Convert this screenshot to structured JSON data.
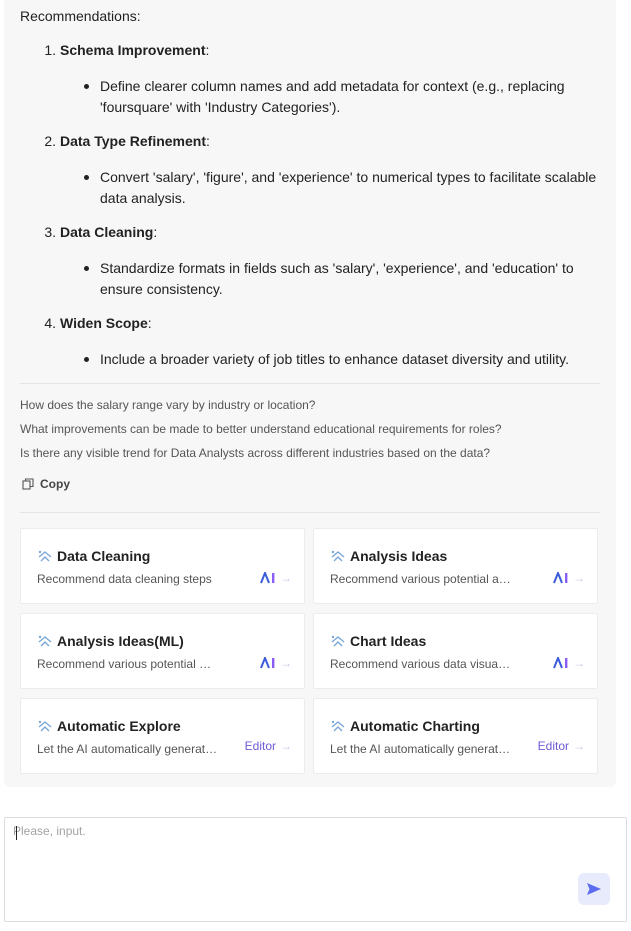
{
  "message": {
    "heading": "Recommendations:",
    "items": [
      {
        "num": "1.",
        "title": "Schema Improvement",
        "suffix": ":",
        "detail": "Define clearer column names and add metadata for context (e.g., replacing 'foursquare' with 'Industry Categories')."
      },
      {
        "num": "2.",
        "title": "Data Type Refinement",
        "suffix": ":",
        "detail": "Convert 'salary', 'figure', and 'experience' to numerical types to facilitate scalable data analysis."
      },
      {
        "num": "3.",
        "title": "Data Cleaning",
        "suffix": ":",
        "detail": "Standardize formats in fields such as 'salary', 'experience', and 'education' to ensure consistency."
      },
      {
        "num": "4.",
        "title": "Widen Scope",
        "suffix": ":",
        "detail": "Include a broader variety of job titles to enhance dataset diversity and utility."
      }
    ]
  },
  "suggestions": [
    "How does the salary range vary by industry or location?",
    "What improvements can be made to better understand educational requirements for roles?",
    "Is there any visible trend for Data Analysts across different industries based on the data?"
  ],
  "copy_label": "Copy",
  "cards": [
    {
      "title": "Data Cleaning",
      "desc": "Recommend data cleaning steps",
      "action": "ai"
    },
    {
      "title": "Analysis Ideas",
      "desc": "Recommend various potential analysis ideas",
      "action": "ai"
    },
    {
      "title": "Analysis Ideas(ML)",
      "desc": "Recommend various potential ML analysis ideas",
      "action": "ai"
    },
    {
      "title": "Chart Ideas",
      "desc": "Recommend various data visualization ideas",
      "action": "ai"
    },
    {
      "title": "Automatic Explore",
      "desc": "Let the AI automatically generate explorations",
      "action": "editor",
      "action_label": "Editor"
    },
    {
      "title": "Automatic Charting",
      "desc": "Let the AI automatically generate charts",
      "action": "editor",
      "action_label": "Editor"
    }
  ],
  "input": {
    "placeholder": "Please, input.",
    "value": ""
  },
  "icons": {
    "copy": "copy-icon",
    "card": "sparkle-icon",
    "ai": "ai-logo-icon",
    "arrow": "arrow-right-icon",
    "send": "send-icon"
  },
  "colors": {
    "accent": "#6f5bd6",
    "send_bg": "#e8ebfb",
    "ai_blue": "#3b5bdb",
    "ai_purple": "#8b5cf6"
  }
}
